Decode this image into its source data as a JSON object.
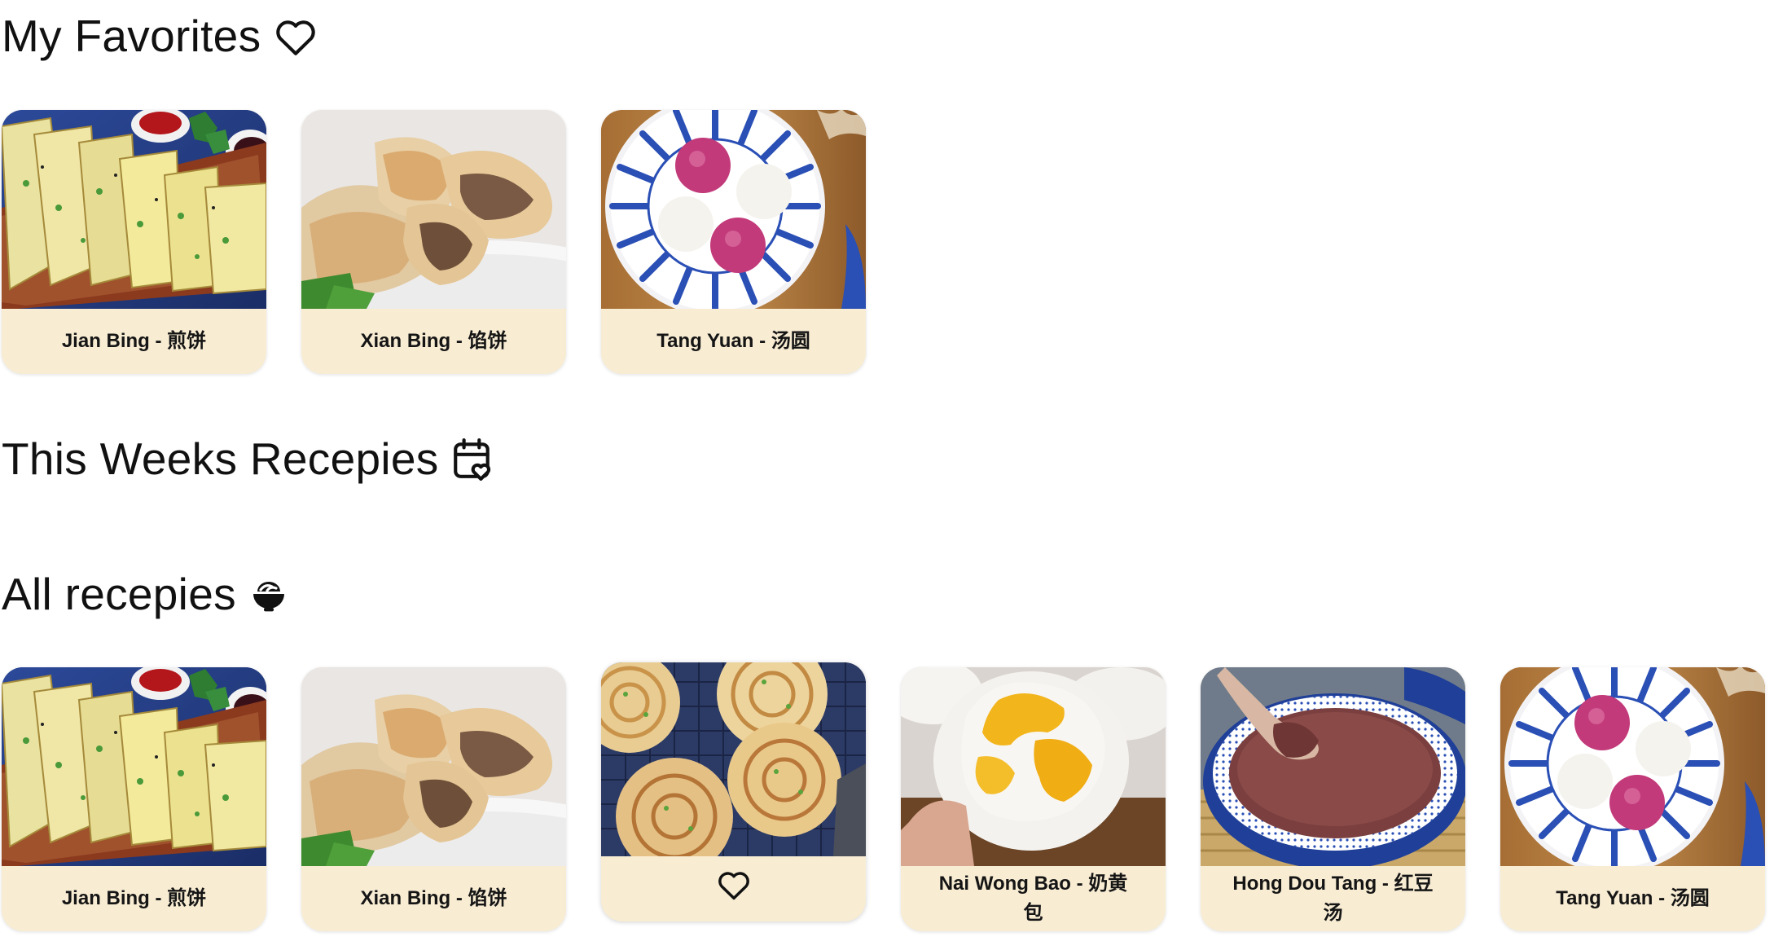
{
  "favorites": {
    "title": "My Favorites",
    "icon": "heart-outline-icon",
    "cards": [
      {
        "label": "Jian Bing - 煎饼",
        "image": "jian-bing-photo"
      },
      {
        "label": "Xian Bing - 馅饼",
        "image": "xian-bing-photo"
      },
      {
        "label": "Tang Yuan - 汤圆",
        "image": "tang-yuan-photo"
      }
    ]
  },
  "weekly": {
    "title": "This Weeks Recepies",
    "icon": "calendar-heart-icon"
  },
  "all": {
    "title": "All recepies",
    "icon": "bowl-icon",
    "cards": [
      {
        "label": "Jian Bing - 煎饼",
        "image": "jian-bing-photo"
      },
      {
        "label": "Xian Bing - 馅饼",
        "image": "xian-bing-photo"
      },
      {
        "label": "",
        "image": "scallion-pancake-photo",
        "hover_icon": "heart-outline-icon"
      },
      {
        "label": "Nai Wong Bao - 奶黄包",
        "image": "nai-wong-bao-photo"
      },
      {
        "label": "Hong Dou Tang - 红豆汤",
        "image": "hong-dou-tang-photo"
      },
      {
        "label": "Tang Yuan - 汤圆",
        "image": "tang-yuan-photo"
      }
    ]
  },
  "colors": {
    "card_caption_bg": "#f8ecd3",
    "text": "#111111"
  }
}
